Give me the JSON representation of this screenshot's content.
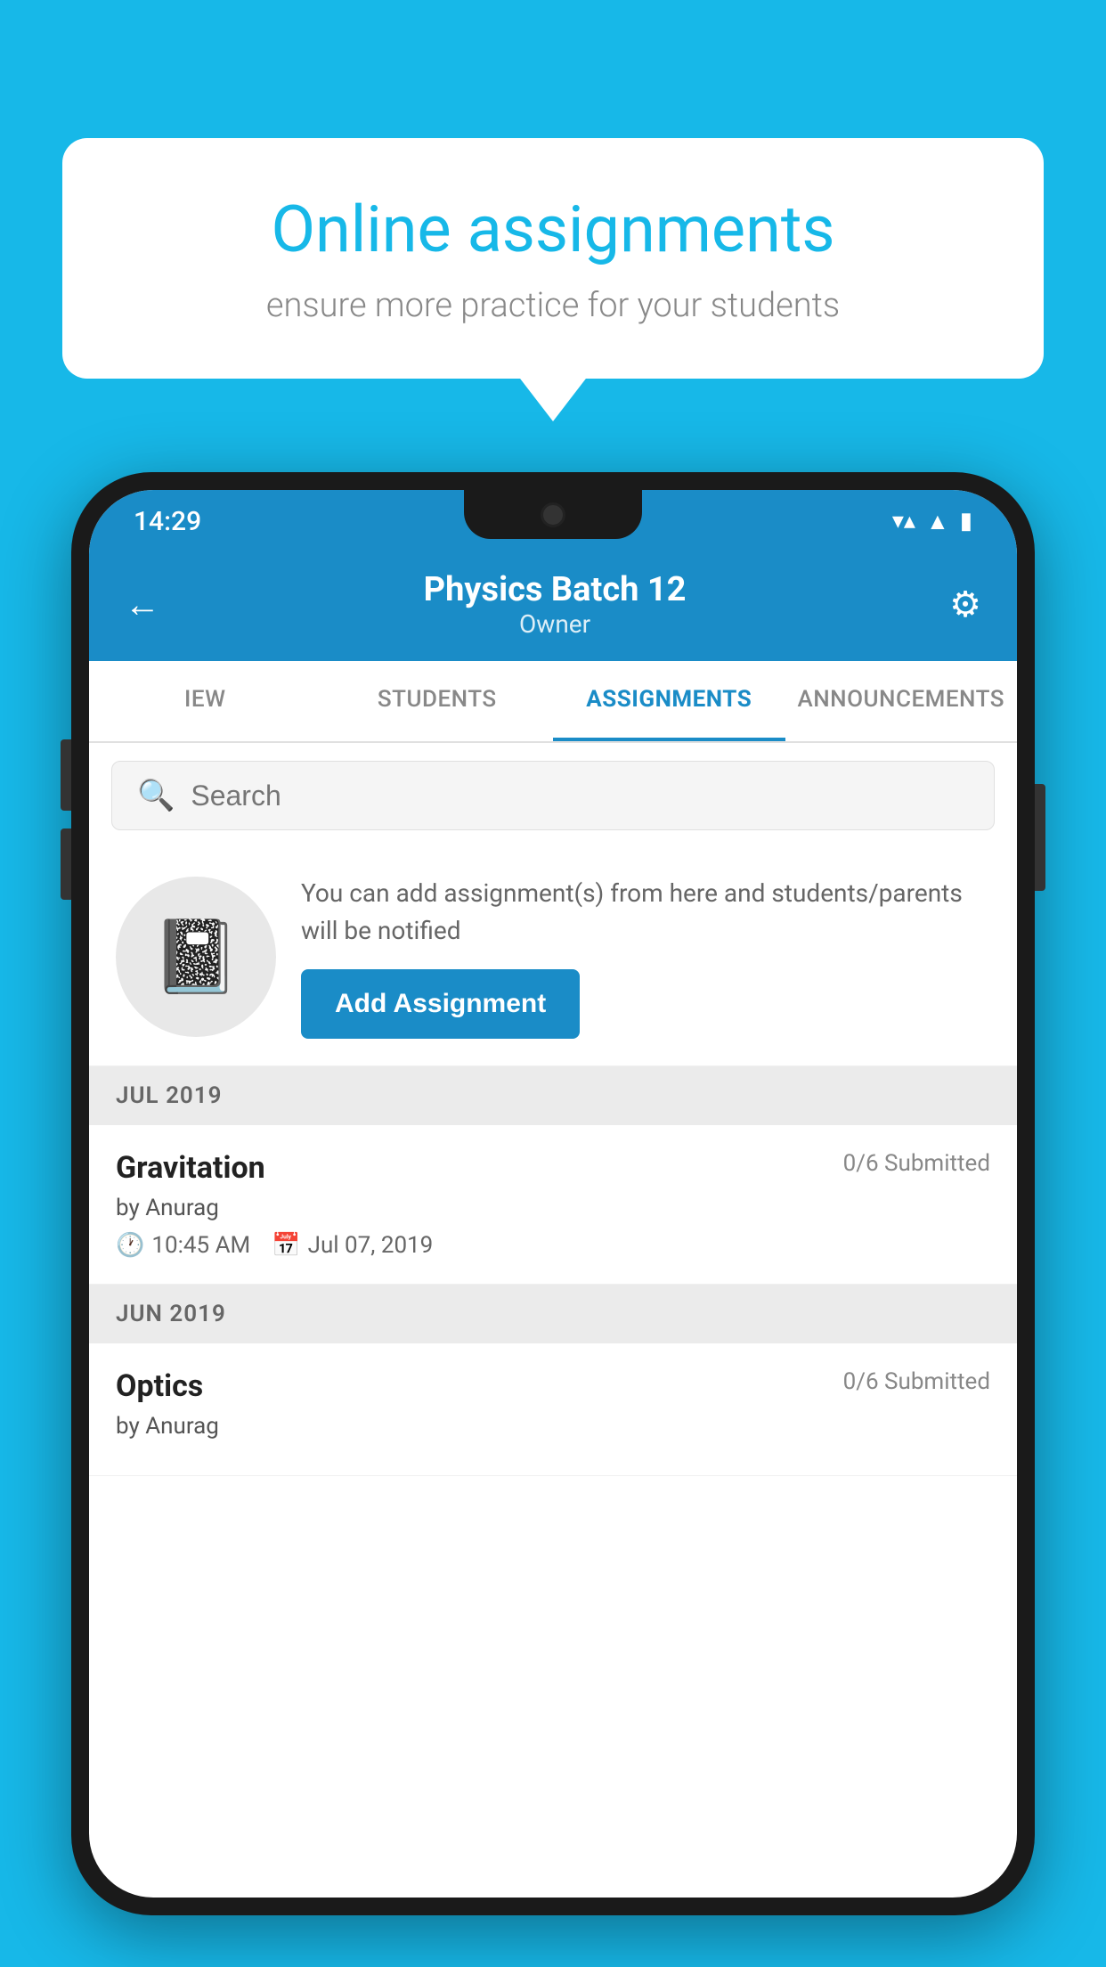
{
  "background_color": "#17b8e8",
  "speech_bubble": {
    "title": "Online assignments",
    "subtitle": "ensure more practice for your students"
  },
  "status_bar": {
    "time": "14:29",
    "wifi": "▼",
    "signal": "▲",
    "battery": "▮"
  },
  "header": {
    "title": "Physics Batch 12",
    "subtitle": "Owner",
    "back_label": "←",
    "settings_label": "⚙"
  },
  "tabs": [
    {
      "id": "iew",
      "label": "IEW",
      "active": false
    },
    {
      "id": "students",
      "label": "STUDENTS",
      "active": false
    },
    {
      "id": "assignments",
      "label": "ASSIGNMENTS",
      "active": true
    },
    {
      "id": "announcements",
      "label": "ANNOUNCEMENTS",
      "active": false
    }
  ],
  "search": {
    "placeholder": "Search"
  },
  "info_card": {
    "description": "You can add assignment(s) from here and students/parents will be notified",
    "add_button_label": "Add Assignment"
  },
  "sections": [
    {
      "month_label": "JUL 2019",
      "assignments": [
        {
          "title": "Gravitation",
          "submitted": "0/6 Submitted",
          "by": "by Anurag",
          "time": "10:45 AM",
          "date": "Jul 07, 2019"
        }
      ]
    },
    {
      "month_label": "JUN 2019",
      "assignments": [
        {
          "title": "Optics",
          "submitted": "0/6 Submitted",
          "by": "by Anurag",
          "time": "",
          "date": ""
        }
      ]
    }
  ]
}
